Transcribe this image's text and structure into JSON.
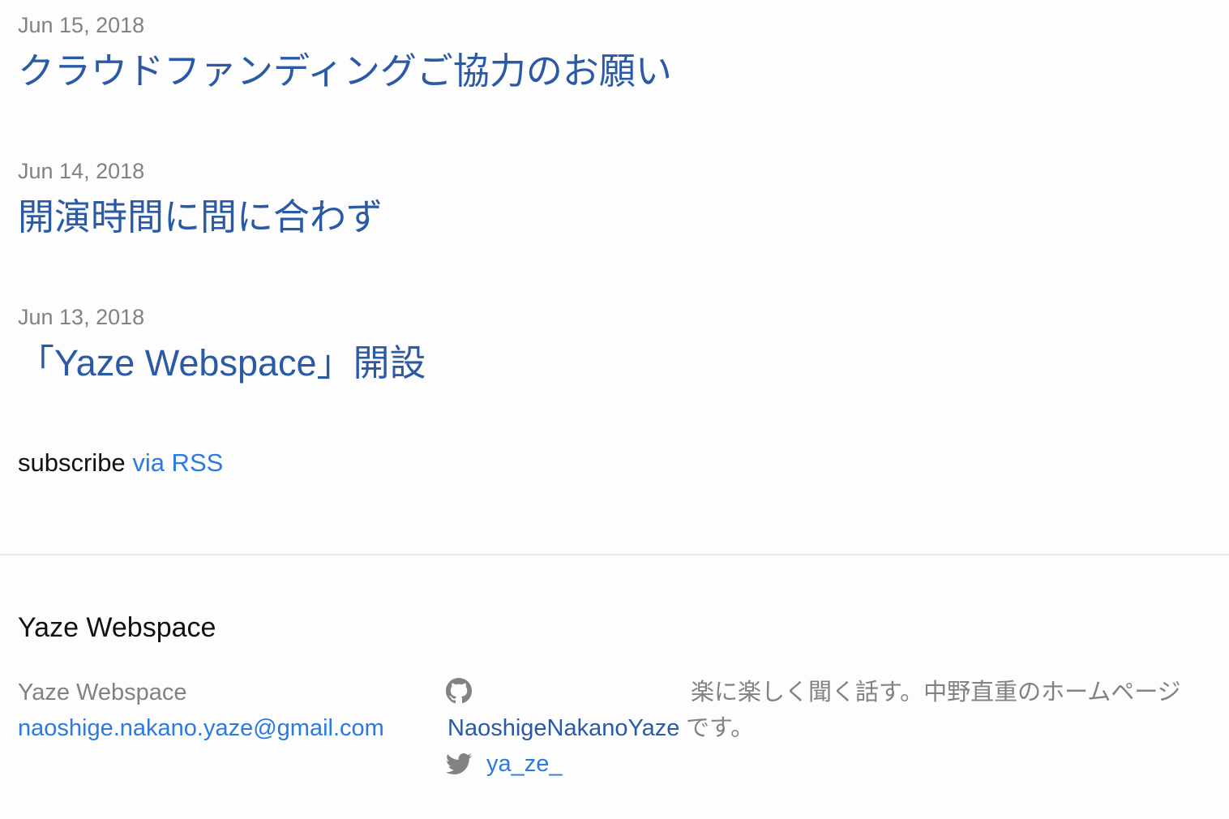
{
  "posts": [
    {
      "date": "Jun 15, 2018",
      "title": "クラウドファンディングご協力のお願い"
    },
    {
      "date": "Jun 14, 2018",
      "title": "開演時間に間に合わず"
    },
    {
      "date": "Jun 13, 2018",
      "title": "「Yaze Webspace」開設"
    }
  ],
  "rss": {
    "prefix": "subscribe",
    "link_label": "via RSS"
  },
  "footer": {
    "heading": "Yaze Webspace",
    "site_name": "Yaze Webspace",
    "email": "naoshige.nakano.yaze@gmail.com",
    "github_username": "NaoshigeNakanoYaze",
    "twitter_username": "ya_ze_",
    "description_line1": "楽に楽しく聞く話す。中野直重のホームページ",
    "description_line2": "です。"
  },
  "colors": {
    "post_link": "#2a5aa5",
    "link": "#2a7ae2",
    "meta": "#828282",
    "background": "#fdfdfd"
  },
  "icons": {
    "github": "github-icon",
    "twitter": "twitter-icon"
  }
}
